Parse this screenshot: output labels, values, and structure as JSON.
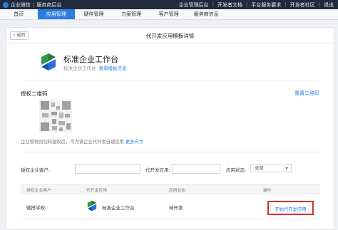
{
  "topbar": {
    "brand": "企业微信",
    "sub": "服务商后台",
    "links": [
      "企业管理后台",
      "开发者文档",
      "平台服务要求",
      "开发者社区",
      "退出"
    ]
  },
  "nav": {
    "items": [
      "首页",
      "应用管理",
      "硬件管理",
      "方案管理",
      "客户管理",
      "服务商信息"
    ],
    "active_index": 1
  },
  "panel": {
    "back_label": "返回",
    "title": "代开发应用模板详情"
  },
  "app": {
    "name": "标准企业工作台",
    "subtitle": "标准企业工作台",
    "view_link": "查看模板信息"
  },
  "qr": {
    "title": "授权二维码",
    "reset_label": "重置二维码",
    "desc": "企业管理员扫码授权后，可为该企业代开发自建应用",
    "more_link": "更多尺寸"
  },
  "filters": {
    "customer_label": "授权企业客户:",
    "app_label": "代开发应用:",
    "status_label": "应用状态:",
    "status_value": "全部"
  },
  "table": {
    "headers": [
      "授权企业客户",
      "代开发应用",
      "应用状态",
      "操作"
    ],
    "rows": [
      {
        "customer": "微搭学校",
        "app": "标准企业工作台",
        "status": "待开发",
        "action": "开始代开发应用"
      }
    ]
  },
  "colors": {
    "accent": "#2b7de1",
    "topbar": "#1e2b3c",
    "highlight": "#d42d2d"
  }
}
